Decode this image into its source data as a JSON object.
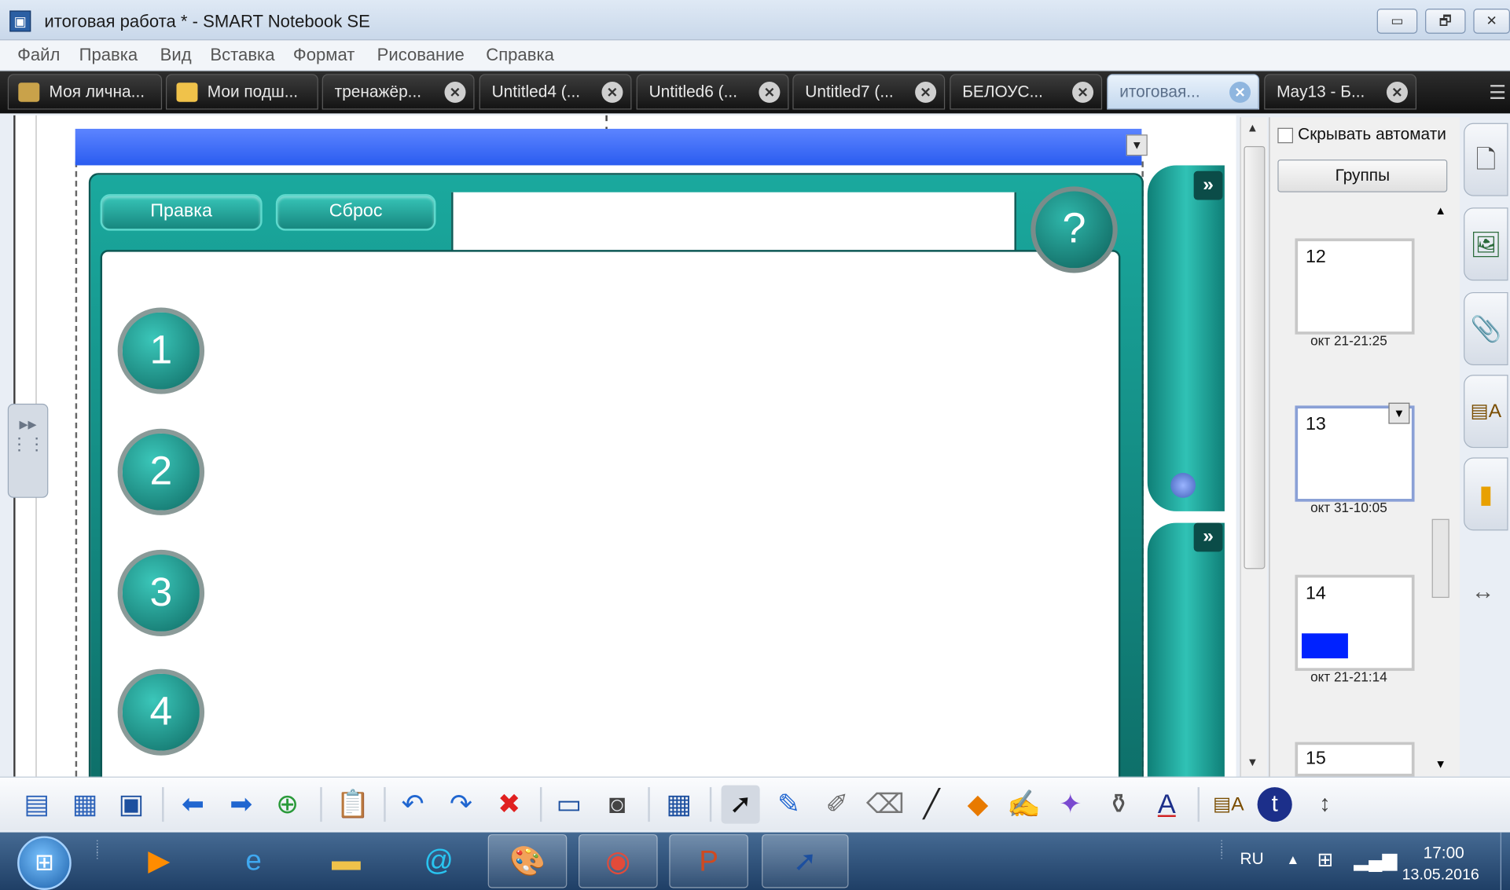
{
  "window": {
    "title": "итоговая работа * - SMART Notebook SE",
    "minimize": "▭",
    "maximize": "🗗",
    "close": "✕"
  },
  "menu": [
    "Файл",
    "Правка",
    "Вид",
    "Вставка",
    "Формат",
    "Рисование",
    "Справка"
  ],
  "tabs": [
    {
      "label": "Моя лична...",
      "icon": "home-icon",
      "closable": false
    },
    {
      "label": "Мои подш...",
      "icon": "folder-icon",
      "closable": false
    },
    {
      "label": "тренажёр...",
      "closable": true
    },
    {
      "label": "Untitled4 (...",
      "closable": true
    },
    {
      "label": "Untitled6 (...",
      "closable": true
    },
    {
      "label": "Untitled7 (...",
      "closable": true
    },
    {
      "label": "БЕЛОУС...",
      "closable": true
    },
    {
      "label": "итоговая...",
      "closable": true,
      "active": true
    },
    {
      "label": "May13 - Б...",
      "closable": true
    }
  ],
  "canvas": {
    "edit_button": "Правка",
    "reset_button": "Сброс",
    "help_label": "?",
    "numbers": [
      "1",
      "2",
      "3",
      "4"
    ],
    "arrow_label": "»"
  },
  "sorter": {
    "autohide_label": "Скрывать автомати",
    "groups_label": "Группы",
    "pages": [
      {
        "num": "12",
        "date": "окт 21-21:25"
      },
      {
        "num": "13",
        "date": "окт 31-10:05",
        "selected": true
      },
      {
        "num": "14",
        "date": "окт 21-21:14"
      },
      {
        "num": "15",
        "date": ""
      }
    ]
  },
  "taskbar": {
    "language": "RU",
    "time": "17:00",
    "date": "13.05.2016"
  },
  "colors": {
    "teal_dark": "#0e6f69",
    "teal_light": "#30c2b5",
    "blue_strip": "#2a5cf0",
    "taskbar": "#1f3f66"
  }
}
